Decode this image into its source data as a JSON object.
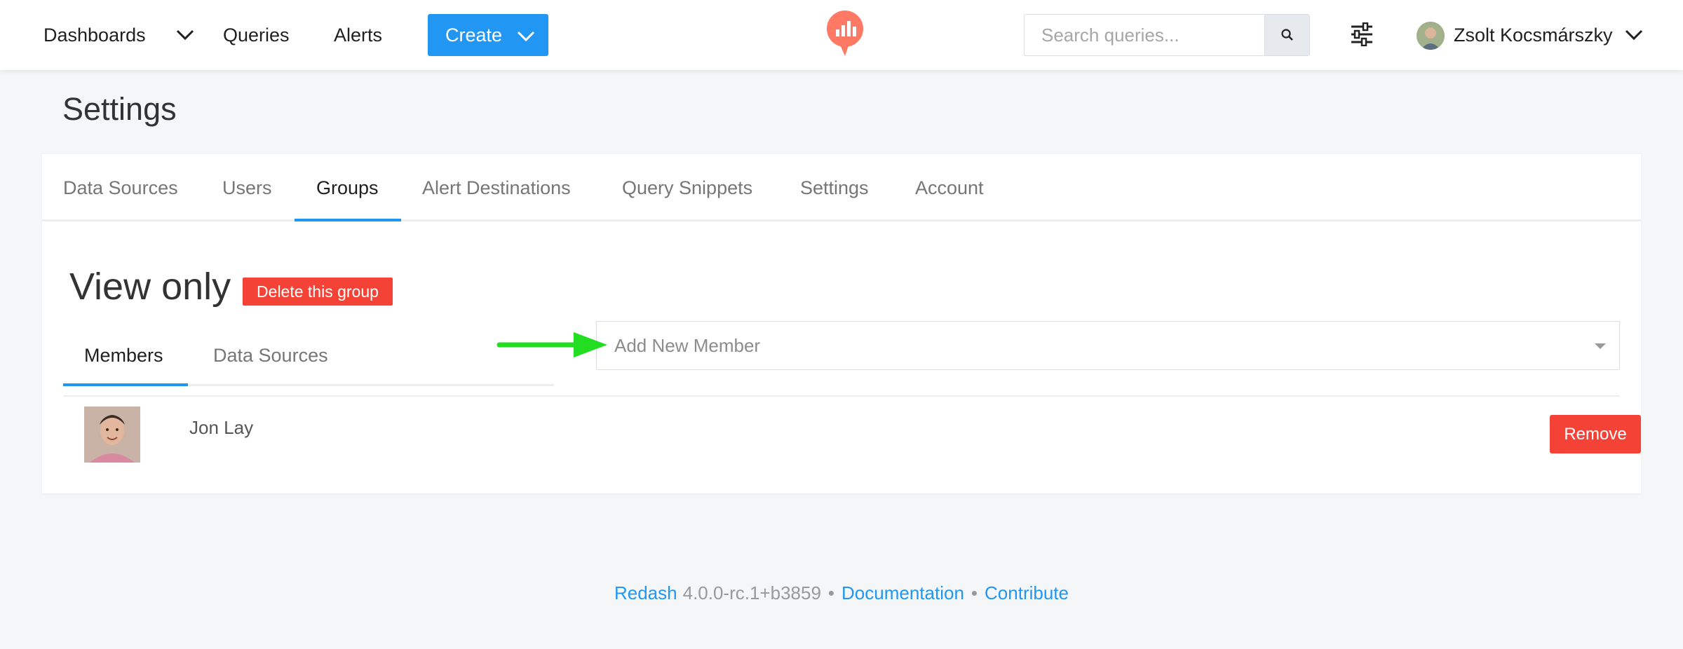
{
  "navbar": {
    "dashboards_label": "Dashboards",
    "queries_label": "Queries",
    "alerts_label": "Alerts",
    "create_label": "Create",
    "search_placeholder": "Search queries...",
    "user_name": "Zsolt Kocsmárszky"
  },
  "page": {
    "title": "Settings"
  },
  "settings_tabs": [
    {
      "label": "Data Sources"
    },
    {
      "label": "Users"
    },
    {
      "label": "Groups",
      "active": true
    },
    {
      "label": "Alert Destinations"
    },
    {
      "label": "Query Snippets"
    },
    {
      "label": "Settings"
    },
    {
      "label": "Account"
    }
  ],
  "group": {
    "name": "View only",
    "delete_label": "Delete this group",
    "subtabs": [
      {
        "label": "Members",
        "active": true
      },
      {
        "label": "Data Sources"
      }
    ],
    "add_member_placeholder": "Add New Member",
    "members": [
      {
        "name": "Jon Lay",
        "remove_label": "Remove"
      }
    ]
  },
  "footer": {
    "app_name": "Redash",
    "version": "4.0.0-rc.1+b3859",
    "separator": "•",
    "documentation_label": "Documentation",
    "contribute_label": "Contribute"
  },
  "colors": {
    "accent": "#2196f3",
    "danger": "#f44336",
    "logo": "#ff7964",
    "arrow": "#22dd22"
  }
}
